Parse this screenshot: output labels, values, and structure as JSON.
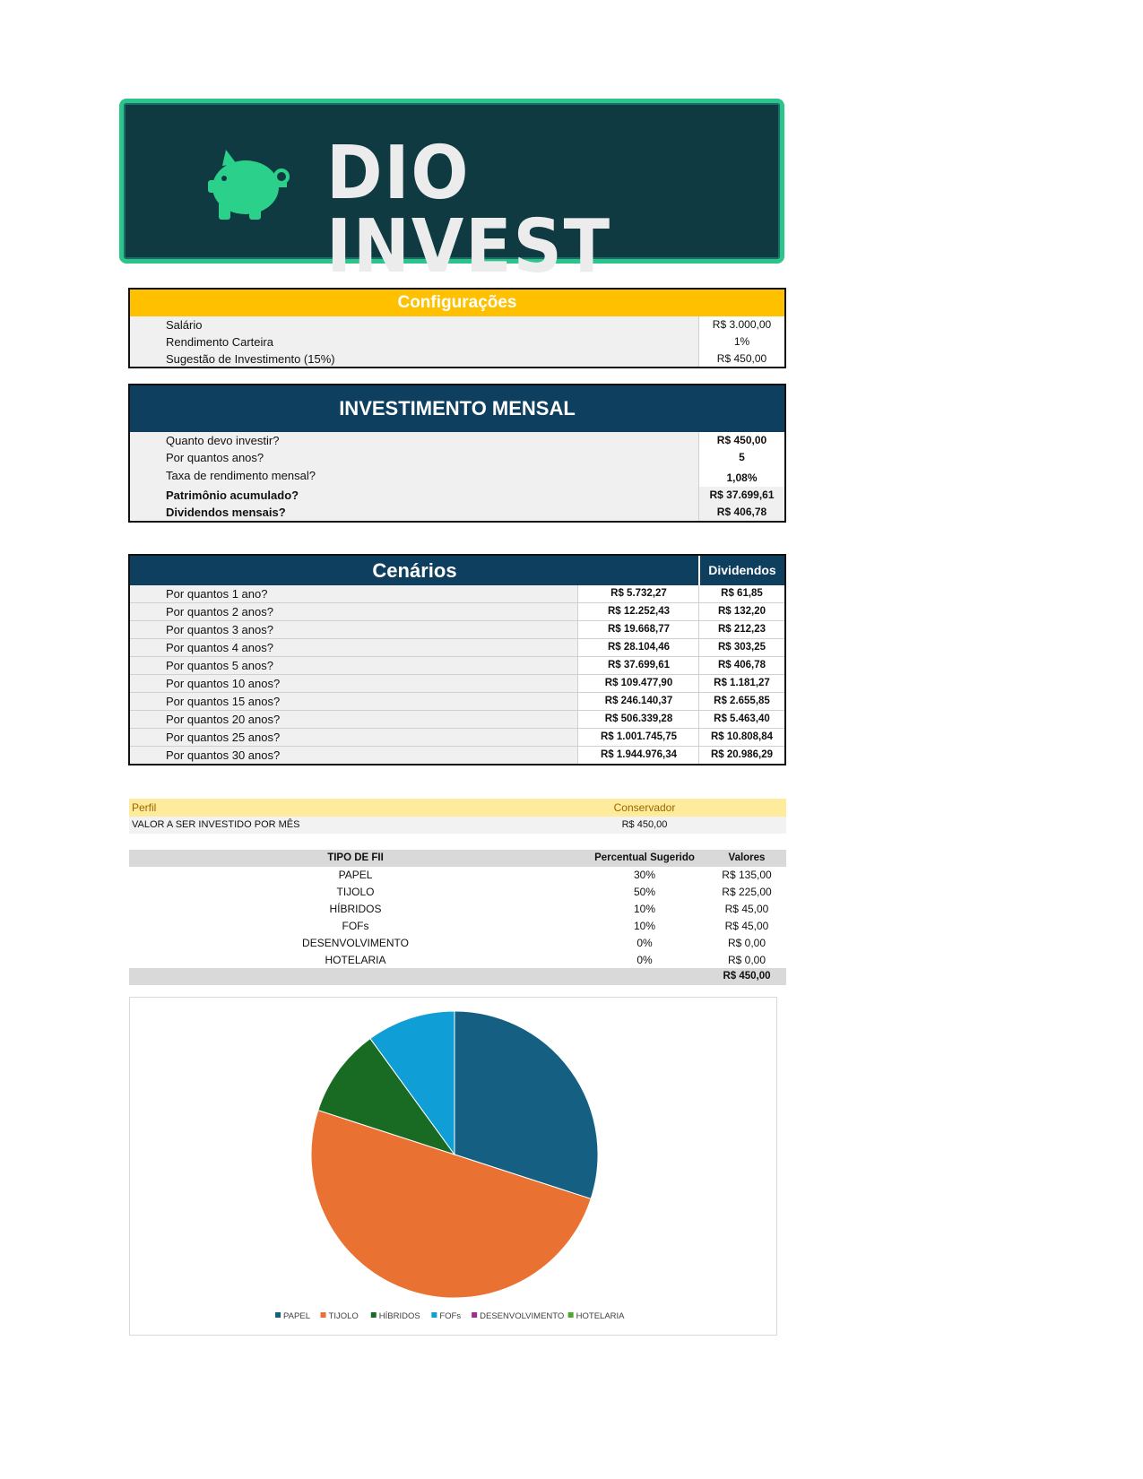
{
  "banner": {
    "title": "DIO INVEST"
  },
  "config": {
    "title": "Configurações",
    "rows": [
      {
        "label": "Salário",
        "value": "R$ 3.000,00"
      },
      {
        "label": "Rendimento Carteira",
        "value": "1%"
      },
      {
        "label": "Sugestão de Investimento (15%)",
        "value": "R$ 450,00"
      }
    ]
  },
  "mensal": {
    "title": "INVESTIMENTO MENSAL",
    "rows": [
      {
        "label": "Quanto devo investir?",
        "value": "R$ 450,00"
      },
      {
        "label": "Por quantos anos?",
        "value": "5"
      },
      {
        "label": "Taxa de rendimento mensal?",
        "value": "1,08%"
      },
      {
        "label": "Patrimônio acumulado?",
        "value": "R$ 37.699,61"
      },
      {
        "label": "Dividendos mensais?",
        "value": "R$ 406,78"
      }
    ]
  },
  "cenarios": {
    "title": "Cenários",
    "dividendos_header": "Dividendos",
    "rows": [
      {
        "label": "Por quantos 1 ano?",
        "patrimonio": "R$ 5.732,27",
        "dividendos": "R$ 61,85"
      },
      {
        "label": "Por quantos 2 anos?",
        "patrimonio": "R$ 12.252,43",
        "dividendos": "R$ 132,20"
      },
      {
        "label": "Por quantos 3 anos?",
        "patrimonio": "R$ 19.668,77",
        "dividendos": "R$ 212,23"
      },
      {
        "label": "Por quantos 4 anos?",
        "patrimonio": "R$ 28.104,46",
        "dividendos": "R$ 303,25"
      },
      {
        "label": "Por quantos 5 anos?",
        "patrimonio": "R$ 37.699,61",
        "dividendos": "R$ 406,78"
      },
      {
        "label": "Por quantos 10 anos?",
        "patrimonio": "R$ 109.477,90",
        "dividendos": "R$ 1.181,27"
      },
      {
        "label": "Por quantos 15 anos?",
        "patrimonio": "R$ 246.140,37",
        "dividendos": "R$ 2.655,85"
      },
      {
        "label": "Por quantos 20 anos?",
        "patrimonio": "R$ 506.339,28",
        "dividendos": "R$ 5.463,40"
      },
      {
        "label": "Por quantos 25 anos?",
        "patrimonio": "R$ 1.001.745,75",
        "dividendos": "R$ 10.808,84"
      },
      {
        "label": "Por quantos 30 anos?",
        "patrimonio": "R$ 1.944.976,34",
        "dividendos": "R$ 20.986,29"
      }
    ]
  },
  "perfil": {
    "label": "Perfil",
    "value": "Conservador"
  },
  "valor_mes": {
    "label": "VALOR A SER INVESTIDO POR MÊS",
    "value": "R$ 450,00"
  },
  "fii": {
    "headers": [
      "TIPO DE FII",
      "Percentual Sugerido",
      "Valores"
    ],
    "rows": [
      {
        "tipo": "PAPEL",
        "pct": "30%",
        "valor": "R$ 135,00"
      },
      {
        "tipo": "TIJOLO",
        "pct": "50%",
        "valor": "R$ 225,00"
      },
      {
        "tipo": "HÍBRIDOS",
        "pct": "10%",
        "valor": "R$ 45,00"
      },
      {
        "tipo": "FOFs",
        "pct": "10%",
        "valor": "R$ 45,00"
      },
      {
        "tipo": "DESENVOLVIMENTO",
        "pct": "0%",
        "valor": "R$ 0,00"
      },
      {
        "tipo": "HOTELARIA",
        "pct": "0%",
        "valor": "R$ 0,00"
      }
    ],
    "total": "R$ 450,00"
  },
  "chart_data": {
    "type": "pie",
    "title": "",
    "categories": [
      "PAPEL",
      "TIJOLO",
      "HÍBRIDOS",
      "FOFs",
      "DESENVOLVIMENTO",
      "HOTELARIA"
    ],
    "values": [
      135,
      225,
      45,
      45,
      0,
      0
    ],
    "colors": [
      "#156082",
      "#e97132",
      "#196b24",
      "#0f9ed5",
      "#a02b93",
      "#4ea72e"
    ],
    "legend_position": "bottom"
  },
  "colors": {
    "banner_bg": "#0f3a42",
    "banner_border": "#2bc58a",
    "config_header": "#ffc000",
    "dark_header": "#0f3f5e"
  }
}
